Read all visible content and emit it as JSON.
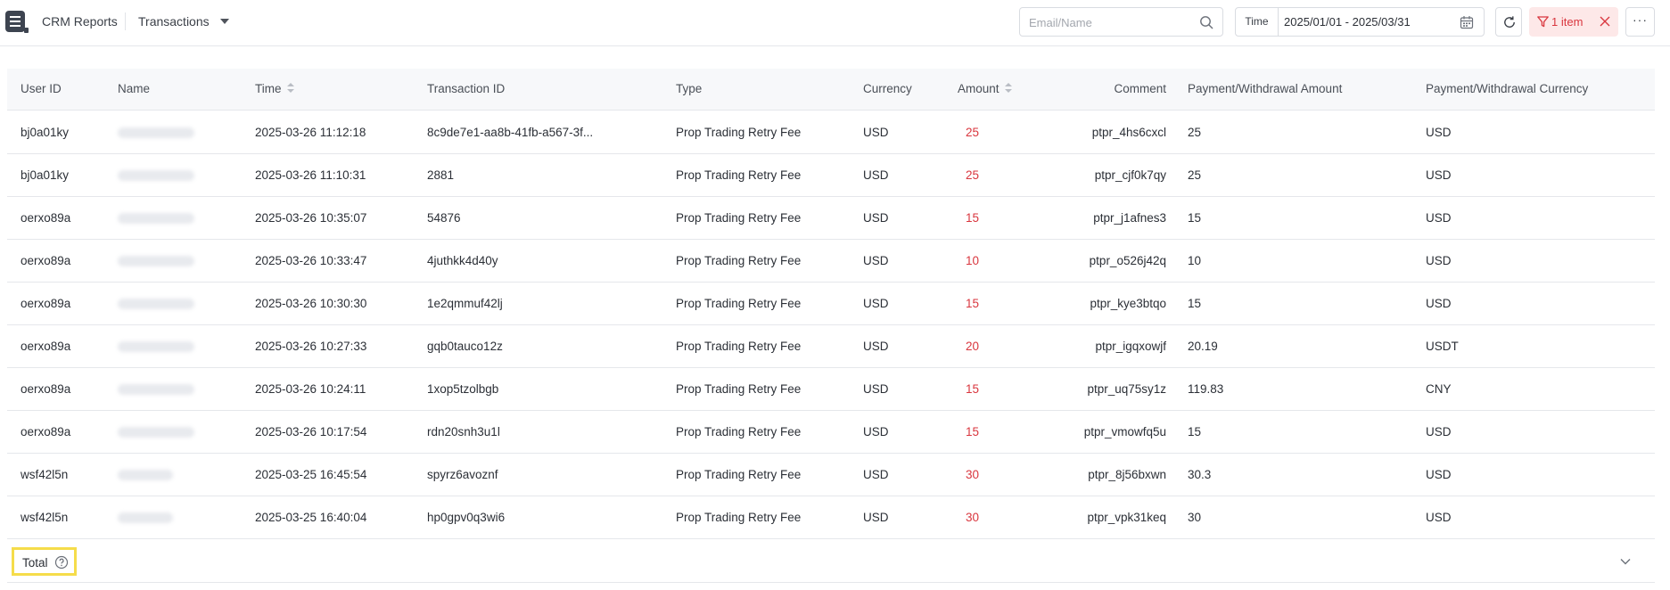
{
  "header": {
    "brand": "CRM Reports",
    "page_select": "Transactions",
    "search_placeholder": "Email/Name",
    "date_label": "Time",
    "date_range": "2025/01/01 - 2025/03/31",
    "filter_chip": "1 item",
    "more_label": "···"
  },
  "colors": {
    "accent_red": "#d9363e",
    "filter_chip_bg": "#fde8e8",
    "highlight_yellow": "#f5dc4a"
  },
  "icons": [
    "menu-icon",
    "chevron-down-icon",
    "search-icon",
    "calendar-icon",
    "refresh-icon",
    "filter-icon",
    "close-icon",
    "help-icon"
  ],
  "table": {
    "columns": [
      "User ID",
      "Name",
      "Time",
      "Transaction ID",
      "Type",
      "Currency",
      "Amount",
      "Comment",
      "Payment/Withdrawal Amount",
      "Payment/Withdrawal Currency"
    ],
    "rows": [
      {
        "user_id": "bj0a01ky",
        "time": "2025-03-26 11:12:18",
        "transaction_id": "8c9de7e1-aa8b-41fb-a567-3f...",
        "type": "Prop Trading Retry Fee",
        "currency": "USD",
        "amount": "25",
        "comment": "ptpr_4hs6cxcl",
        "pw_amount": "25",
        "pw_currency": "USD"
      },
      {
        "user_id": "bj0a01ky",
        "time": "2025-03-26 11:10:31",
        "transaction_id": "2881",
        "type": "Prop Trading Retry Fee",
        "currency": "USD",
        "amount": "25",
        "comment": "ptpr_cjf0k7qy",
        "pw_amount": "25",
        "pw_currency": "USD"
      },
      {
        "user_id": "oerxo89a",
        "time": "2025-03-26 10:35:07",
        "transaction_id": "54876",
        "type": "Prop Trading Retry Fee",
        "currency": "USD",
        "amount": "15",
        "comment": "ptpr_j1afnes3",
        "pw_amount": "15",
        "pw_currency": "USD"
      },
      {
        "user_id": "oerxo89a",
        "time": "2025-03-26 10:33:47",
        "transaction_id": "4juthkk4d40y",
        "type": "Prop Trading Retry Fee",
        "currency": "USD",
        "amount": "10",
        "comment": "ptpr_o526j42q",
        "pw_amount": "10",
        "pw_currency": "USD"
      },
      {
        "user_id": "oerxo89a",
        "time": "2025-03-26 10:30:30",
        "transaction_id": "1e2qmmuf42lj",
        "type": "Prop Trading Retry Fee",
        "currency": "USD",
        "amount": "15",
        "comment": "ptpr_kye3btqo",
        "pw_amount": "15",
        "pw_currency": "USD"
      },
      {
        "user_id": "oerxo89a",
        "time": "2025-03-26 10:27:33",
        "transaction_id": "gqb0tauco12z",
        "type": "Prop Trading Retry Fee",
        "currency": "USD",
        "amount": "20",
        "comment": "ptpr_igqxowjf",
        "pw_amount": "20.19",
        "pw_currency": "USDT"
      },
      {
        "user_id": "oerxo89a",
        "time": "2025-03-26 10:24:11",
        "transaction_id": "1xop5tzolbgb",
        "type": "Prop Trading Retry Fee",
        "currency": "USD",
        "amount": "15",
        "comment": "ptpr_uq75sy1z",
        "pw_amount": "119.83",
        "pw_currency": "CNY"
      },
      {
        "user_id": "oerxo89a",
        "time": "2025-03-26 10:17:54",
        "transaction_id": "rdn20snh3u1l",
        "type": "Prop Trading Retry Fee",
        "currency": "USD",
        "amount": "15",
        "comment": "ptpr_vmowfq5u",
        "pw_amount": "15",
        "pw_currency": "USD"
      },
      {
        "user_id": "wsf42l5n",
        "time": "2025-03-25 16:45:54",
        "transaction_id": "spyrz6avoznf",
        "type": "Prop Trading Retry Fee",
        "currency": "USD",
        "amount": "30",
        "comment": "ptpr_8j56bxwn",
        "pw_amount": "30.3",
        "pw_currency": "USD"
      },
      {
        "user_id": "wsf42l5n",
        "time": "2025-03-25 16:40:04",
        "transaction_id": "hp0gpv0q3wi6",
        "type": "Prop Trading Retry Fee",
        "currency": "USD",
        "amount": "30",
        "comment": "ptpr_vpk31keq",
        "pw_amount": "30",
        "pw_currency": "USD"
      }
    ],
    "total_label": "Total"
  }
}
